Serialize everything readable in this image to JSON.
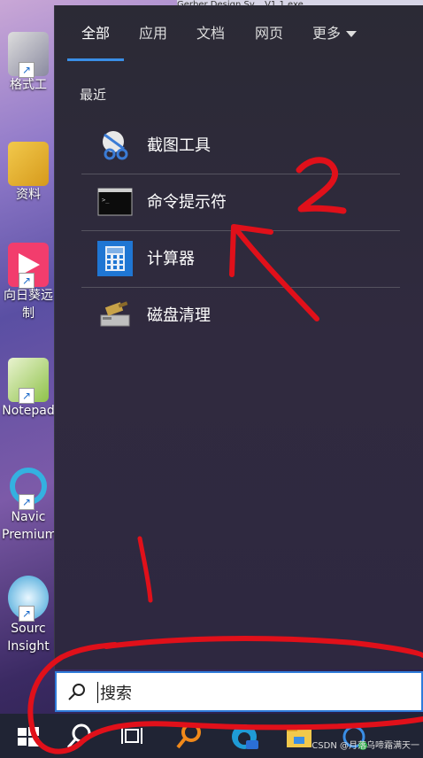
{
  "desktop": {
    "icons": [
      {
        "label": "格式工"
      },
      {
        "label": "资料"
      },
      {
        "label": "向日葵远"
      },
      {
        "label": "制"
      },
      {
        "label": "Notepad"
      },
      {
        "label": "Navic"
      },
      {
        "label": "Premium"
      },
      {
        "label": "Sourc"
      },
      {
        "label": "Insight"
      }
    ]
  },
  "top_strip": {
    "text": "Gerber   Design Sy...   V1.1.exe"
  },
  "start_menu": {
    "tabs": [
      {
        "label": "全部"
      },
      {
        "label": "应用"
      },
      {
        "label": "文档"
      },
      {
        "label": "网页"
      },
      {
        "label": "更多"
      }
    ],
    "section_title": "最近",
    "recent": [
      {
        "label": "截图工具",
        "icon": "snipping-tool-icon"
      },
      {
        "label": "命令提示符",
        "icon": "command-prompt-icon"
      },
      {
        "label": "计算器",
        "icon": "calculator-icon"
      },
      {
        "label": "磁盘清理",
        "icon": "disk-cleanup-icon"
      }
    ]
  },
  "search": {
    "placeholder": "搜索"
  },
  "taskbar": {
    "watermark": "CSDN @月落乌啼霜满天一"
  },
  "annotations": {
    "label_1": "1",
    "label_2": "2"
  },
  "colors": {
    "accent": "#3a8ee6",
    "annotation": "#e0101a"
  }
}
